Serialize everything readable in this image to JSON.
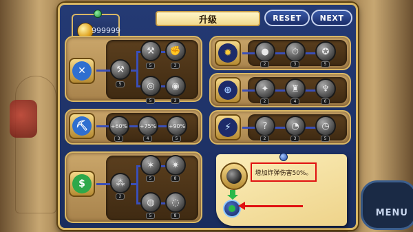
{
  "header": {
    "title": "升级",
    "reset_label": "RESET",
    "next_label": "NEXT"
  },
  "wallet": {
    "coins": "999999"
  },
  "side": {
    "menu_label": "MENU"
  },
  "skills": {
    "tree1": {
      "nodes": [
        {
          "level": "5"
        },
        {
          "level": "5"
        },
        {
          "level": "3"
        },
        {
          "level": "5"
        },
        {
          "level": "3"
        }
      ]
    },
    "tree2": {
      "nodes": [
        {
          "label": "+60%",
          "level": "3"
        },
        {
          "label": "+75%",
          "level": "4"
        },
        {
          "label": "+90%",
          "level": "5"
        }
      ]
    },
    "tree3": {
      "nodes": [
        {
          "level": "2"
        },
        {
          "level": "5"
        },
        {
          "level": "8"
        },
        {
          "level": "5"
        },
        {
          "level": "8"
        }
      ]
    },
    "tree4": {
      "nodes": [
        {
          "level": "2"
        },
        {
          "level": "3"
        },
        {
          "level": "5"
        }
      ]
    },
    "tree5": {
      "nodes": [
        {
          "level": "2"
        },
        {
          "level": "4"
        },
        {
          "level": "6"
        }
      ]
    },
    "tree6": {
      "nodes": [
        {
          "level": "2"
        },
        {
          "level": "3"
        },
        {
          "level": "5"
        }
      ]
    }
  },
  "tooltip": {
    "description": "增加炸弹伤害50%。"
  }
}
